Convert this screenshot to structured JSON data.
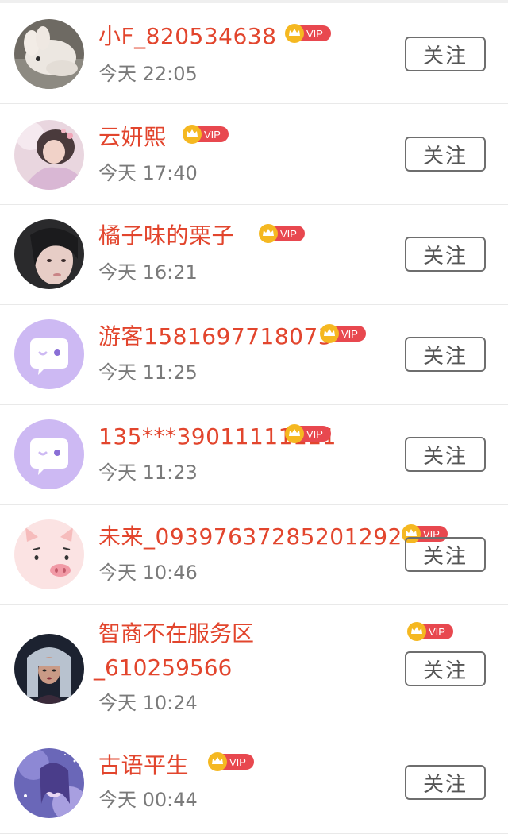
{
  "users": [
    {
      "name": "小F_820534638",
      "badge": "VIP",
      "time": "今天 22:05",
      "follow": "关注",
      "avatar": "photo-avatar-rabbit"
    },
    {
      "name": "云妍熙",
      "badge": "VIP",
      "time": "今天 17:40",
      "follow": "关注",
      "avatar": "photo-avatar-girl"
    },
    {
      "name": "橘子味的栗子",
      "badge": "VIP",
      "time": "今天 16:21",
      "follow": "关注",
      "avatar": "photo-avatar-portrait"
    },
    {
      "name": "游客1581697718073",
      "badge": "VIP",
      "time": "今天 11:25",
      "follow": "关注",
      "avatar": "default-chat-avatar"
    },
    {
      "name": "135***39011111111",
      "badge": "VIP",
      "time": "今天 11:23",
      "follow": "关注",
      "avatar": "default-chat-avatar"
    },
    {
      "name": "未来_09397637285201292",
      "badge": "VIP",
      "time": "今天 10:46",
      "follow": "关注",
      "avatar": "pig-avatar"
    },
    {
      "name_line1": "智商不在服务区",
      "name_line2": "_610259566",
      "badge": "VIP",
      "time": "今天 10:24",
      "follow": "关注",
      "avatar": "illustrated-avatar"
    },
    {
      "name": "古语平生",
      "badge": "VIP",
      "time": "今天 00:44",
      "follow": "关注",
      "avatar": "fantasy-avatar"
    }
  ],
  "colors": {
    "name": "#e2452d",
    "vip_badge": "#e8484f",
    "crown": "#f5b821",
    "default_avatar": "#cdb9f3"
  }
}
